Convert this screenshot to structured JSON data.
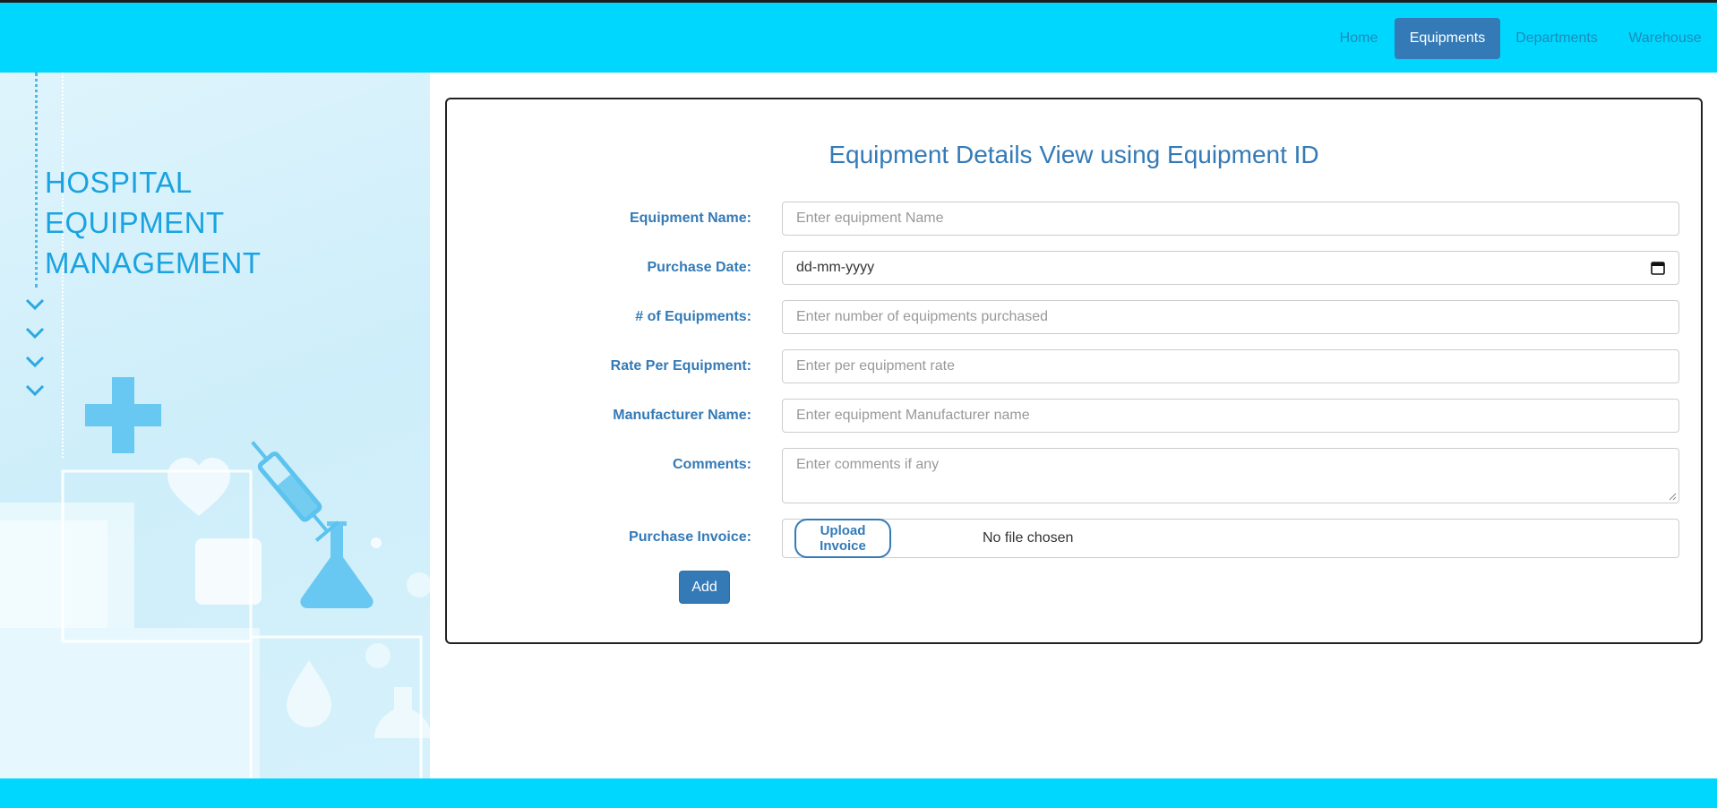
{
  "nav": {
    "items": [
      {
        "label": "Home"
      },
      {
        "label": "Equipments"
      },
      {
        "label": "Departments"
      },
      {
        "label": "Warehouse"
      }
    ],
    "active_index": 1
  },
  "sidebar": {
    "brand_lines": [
      "HOSPITAL",
      "EQUIPMENT",
      "MANAGEMENT"
    ]
  },
  "form": {
    "title": "Equipment Details View using Equipment ID",
    "equipment_name": {
      "label": "Equipment Name:",
      "placeholder": "Enter equipment Name"
    },
    "purchase_date": {
      "label": "Purchase Date:",
      "value": "dd-mm-yyyy"
    },
    "num_equipments": {
      "label": "# of Equipments:",
      "placeholder": "Enter number of equipments purchased"
    },
    "rate": {
      "label": "Rate Per Equipment:",
      "placeholder": "Enter per equipment rate"
    },
    "manufacturer": {
      "label": "Manufacturer Name:",
      "placeholder": "Enter equipment Manufacturer name"
    },
    "comments": {
      "label": "Comments:",
      "placeholder": "Enter comments if any"
    },
    "invoice": {
      "label": "Purchase Invoice:",
      "button": "Upload Invoice",
      "status": "No file chosen"
    },
    "add_label": "Add"
  },
  "colors": {
    "nav_bg": "#00d7ff",
    "accent": "#337ab7",
    "brand_text": "#1aa3e0"
  }
}
